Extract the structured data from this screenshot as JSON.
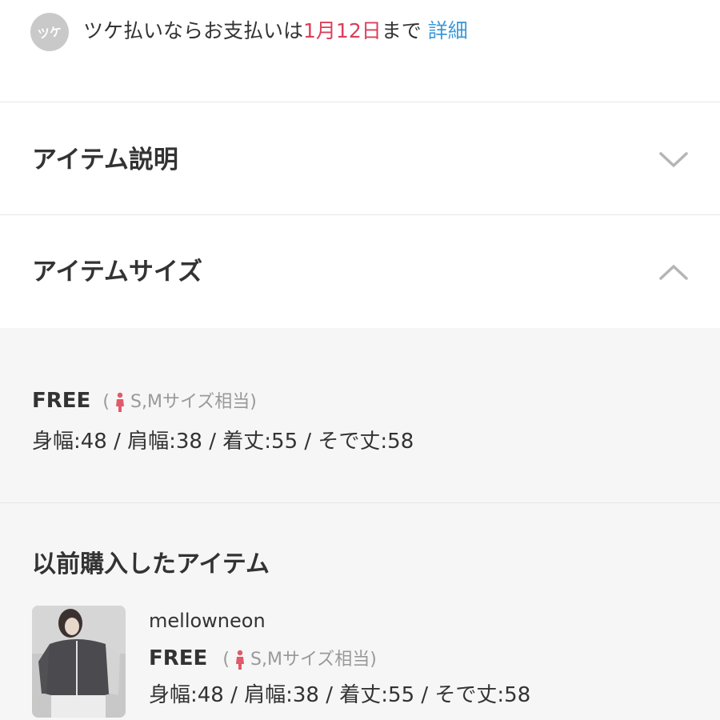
{
  "payment": {
    "logo_text": "ツケ",
    "text_before": "ツケ払いならお支払いは",
    "date": "1月12日",
    "text_after": "まで",
    "link": "詳細"
  },
  "accordions": [
    {
      "title": "アイテム説明",
      "state": "collapsed",
      "icon": "chevron-down-icon"
    },
    {
      "title": "アイテムサイズ",
      "state": "expanded",
      "icon": "chevron-up-icon"
    }
  ],
  "size_info": {
    "size": "FREE",
    "note_open": "(",
    "note": "S,Mサイズ相当)",
    "measurements": "身幅:48 / 肩幅:38 / 着丈:55 / そで丈:58"
  },
  "previous_purchases": {
    "title": "以前購入したアイテム",
    "items": [
      {
        "brand": "mellowneon",
        "size": "FREE",
        "note_open": "(",
        "note": "S,Mサイズ相当)",
        "measurements": "身幅:48 / 肩幅:38 / 着丈:55 / そで丈:58"
      }
    ]
  },
  "colors": {
    "accent_date": "#d9405a",
    "link": "#3a9ad9",
    "person_icon": "#e05a6a",
    "panel_bg": "#f6f6f6"
  }
}
